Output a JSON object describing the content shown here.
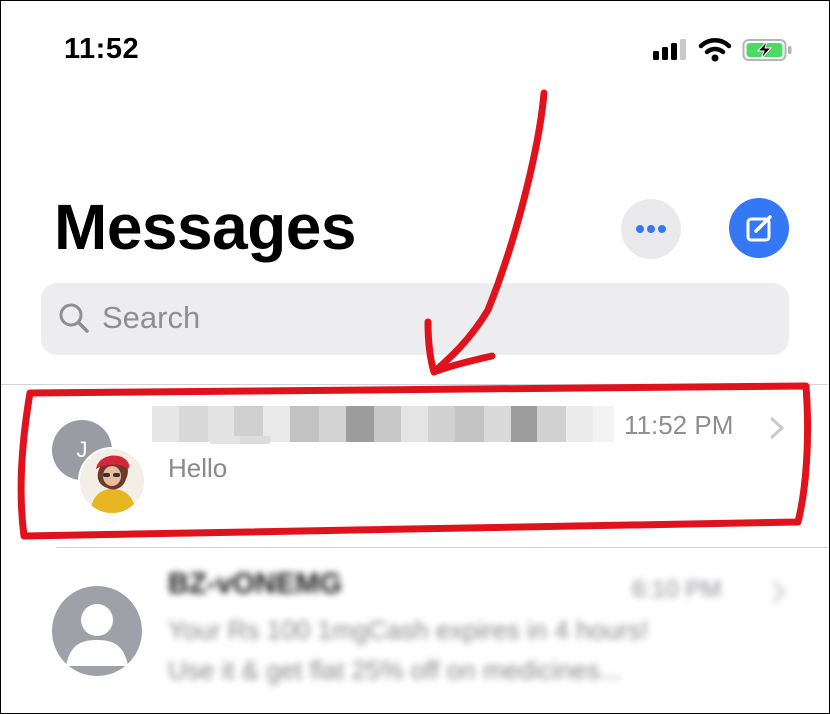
{
  "status_bar": {
    "time": "11:52"
  },
  "header": {
    "title": "Messages"
  },
  "search": {
    "placeholder": "Search"
  },
  "conversations": [
    {
      "avatar_initial": "J",
      "time": "11:52 PM",
      "preview": "Hello",
      "annotated": true
    },
    {
      "sender": "BZ-vONEMG",
      "time": "6:10 PM",
      "preview_line1": "Your Rs 100 1mgCash expires in 4 hours!",
      "preview_line2": "Use it & get flat 25% off on medicines..."
    }
  ],
  "colors": {
    "accent_blue": "#3478f6",
    "annotation_red": "#e0131d",
    "secondary_text": "#8e8e93",
    "battery_green": "#4cd964"
  }
}
